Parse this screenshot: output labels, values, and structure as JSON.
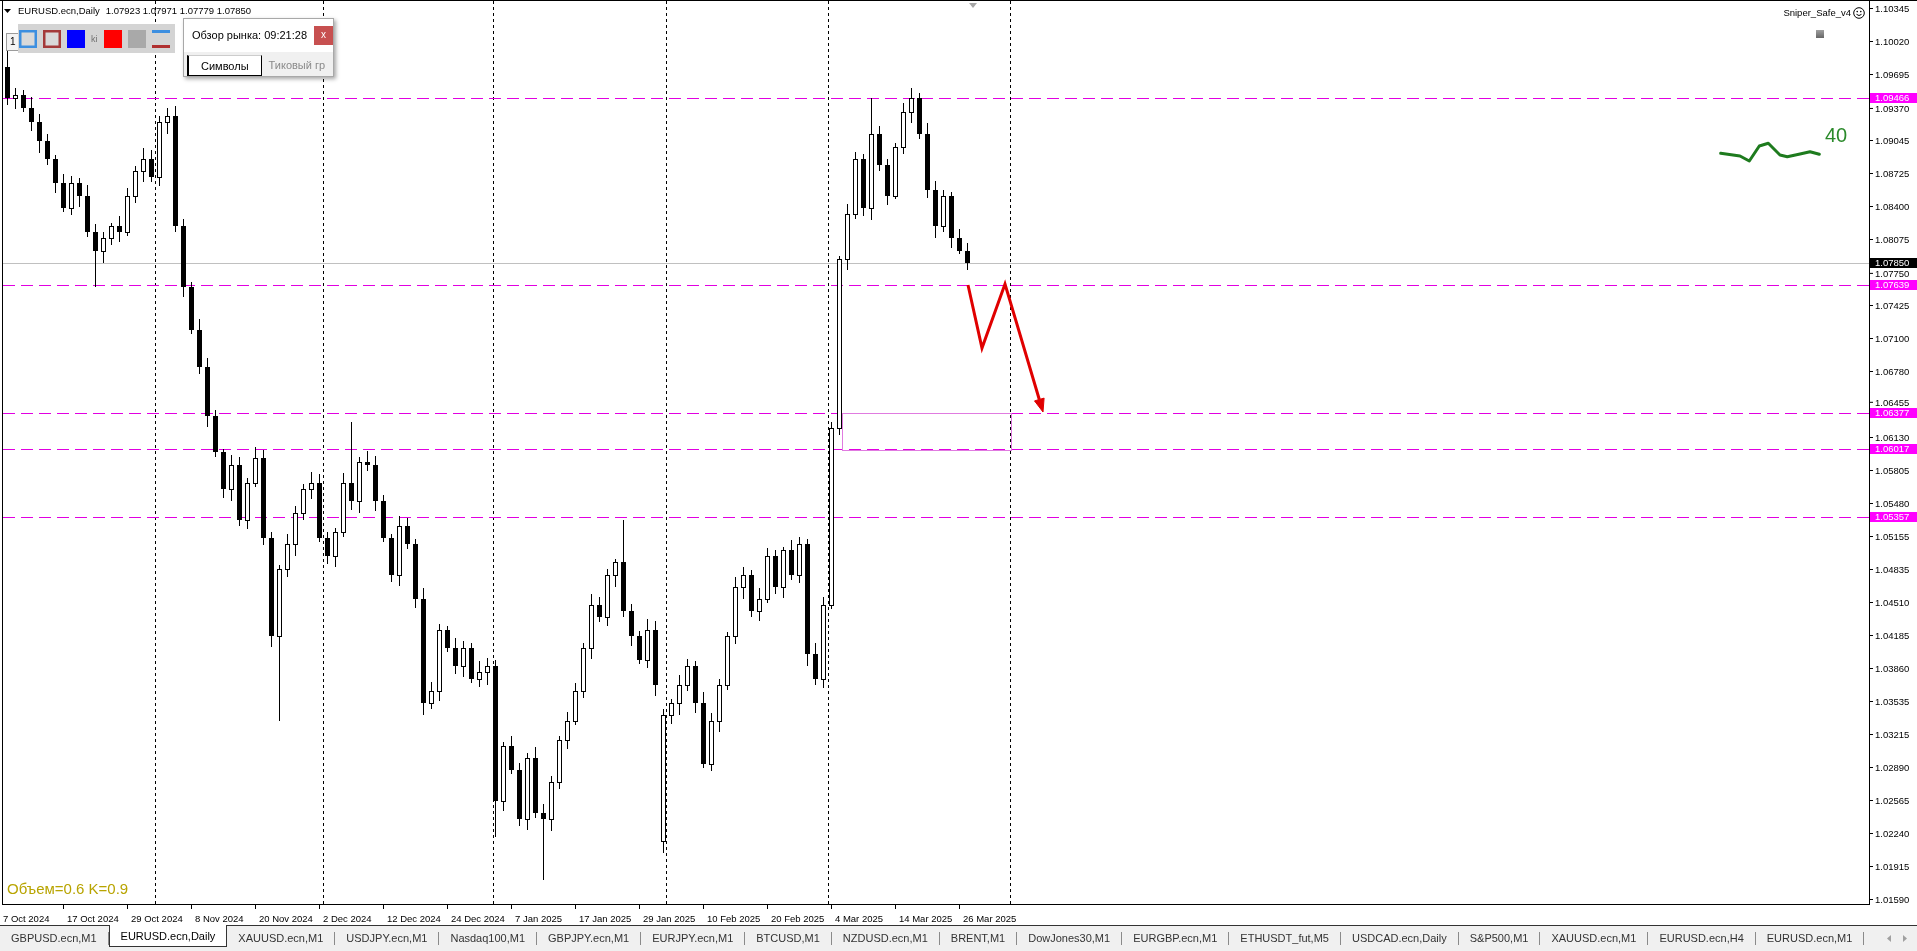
{
  "header": {
    "symbol": "EURUSD.ecn,Daily",
    "prices": "1.07923 1.07971 1.07779 1.07850"
  },
  "toolbar": {
    "field": "1",
    "overlapped_label": "ki",
    "swatches": [
      {
        "kind": "outline",
        "color": "#3d8fe0"
      },
      {
        "kind": "outline",
        "color": "#a43a3a"
      },
      {
        "kind": "fill",
        "color": "#0000ff"
      },
      {
        "kind": "fill",
        "color": "#ff0000"
      },
      {
        "kind": "fill",
        "color": "#a9a9a9"
      },
      {
        "kind": "lines"
      }
    ]
  },
  "market_watch": {
    "title": "Обзор рынка: 09:21:28",
    "close": "x",
    "tabs": [
      {
        "label": "Символы",
        "selected": true
      },
      {
        "label": "Тиковый гр",
        "selected": false
      }
    ]
  },
  "indicator": {
    "name": "Sniper_Safe_v4",
    "value": "40"
  },
  "volume_note": "Объем=0.6 K=0.9",
  "levels": [
    {
      "label": "1.09466"
    },
    {
      "label": "1.07639"
    },
    {
      "label": "1.06377"
    },
    {
      "label": "1.06017"
    },
    {
      "label": "1.05357"
    }
  ],
  "current_price": "1.07850",
  "price_axis": [
    "1.10345",
    "1.10020",
    "1.09695",
    "1.09370",
    "1.09045",
    "1.08725",
    "1.08400",
    "1.08075",
    "1.07750",
    "1.07425",
    "1.07100",
    "1.06780",
    "1.06455",
    "1.06130",
    "1.05805",
    "1.05480",
    "1.05155",
    "1.04835",
    "1.04510",
    "1.04185",
    "1.03860",
    "1.03535",
    "1.03215",
    "1.02890",
    "1.02565",
    "1.02240",
    "1.01915",
    "1.01590"
  ],
  "time_axis": [
    "7 Oct 2024",
    "17 Oct 2024",
    "29 Oct 2024",
    "8 Nov 2024",
    "20 Nov 2024",
    "2 Dec 2024",
    "12 Dec 2024",
    "24 Dec 2024",
    "7 Jan 2025",
    "17 Jan 2025",
    "29 Jan 2025",
    "10 Feb 2025",
    "20 Feb 2025",
    "4 Mar 2025",
    "14 Mar 2025",
    "26 Mar 2025"
  ],
  "chart_tabs": [
    {
      "label": "GBPUSD.ecn,M1",
      "selected": false
    },
    {
      "label": "EURUSD.ecn,Daily",
      "selected": true
    },
    {
      "label": "XAUUSD.ecn,M1",
      "selected": false
    },
    {
      "label": "USDJPY.ecn,M1",
      "selected": false
    },
    {
      "label": "Nasdaq100,M1",
      "selected": false
    },
    {
      "label": "GBPJPY.ecn,M1",
      "selected": false
    },
    {
      "label": "EURJPY.ecn,M1",
      "selected": false
    },
    {
      "label": "BTCUSD,M1",
      "selected": false
    },
    {
      "label": "NZDUSD.ecn,M1",
      "selected": false
    },
    {
      "label": "BRENT,M1",
      "selected": false
    },
    {
      "label": "DowJones30,M1",
      "selected": false
    },
    {
      "label": "EURGBP.ecn,M1",
      "selected": false
    },
    {
      "label": "ETHUSDT_fut,M5",
      "selected": false
    },
    {
      "label": "USDCAD.ecn,Daily",
      "selected": false
    },
    {
      "label": "S&P500,M1",
      "selected": false
    },
    {
      "label": "XAUUSD.ecn,M1",
      "selected": false
    },
    {
      "label": "EURUSD.ecn,H4",
      "selected": false
    },
    {
      "label": "EURUSD.ecn,M1",
      "selected": false
    }
  ]
}
